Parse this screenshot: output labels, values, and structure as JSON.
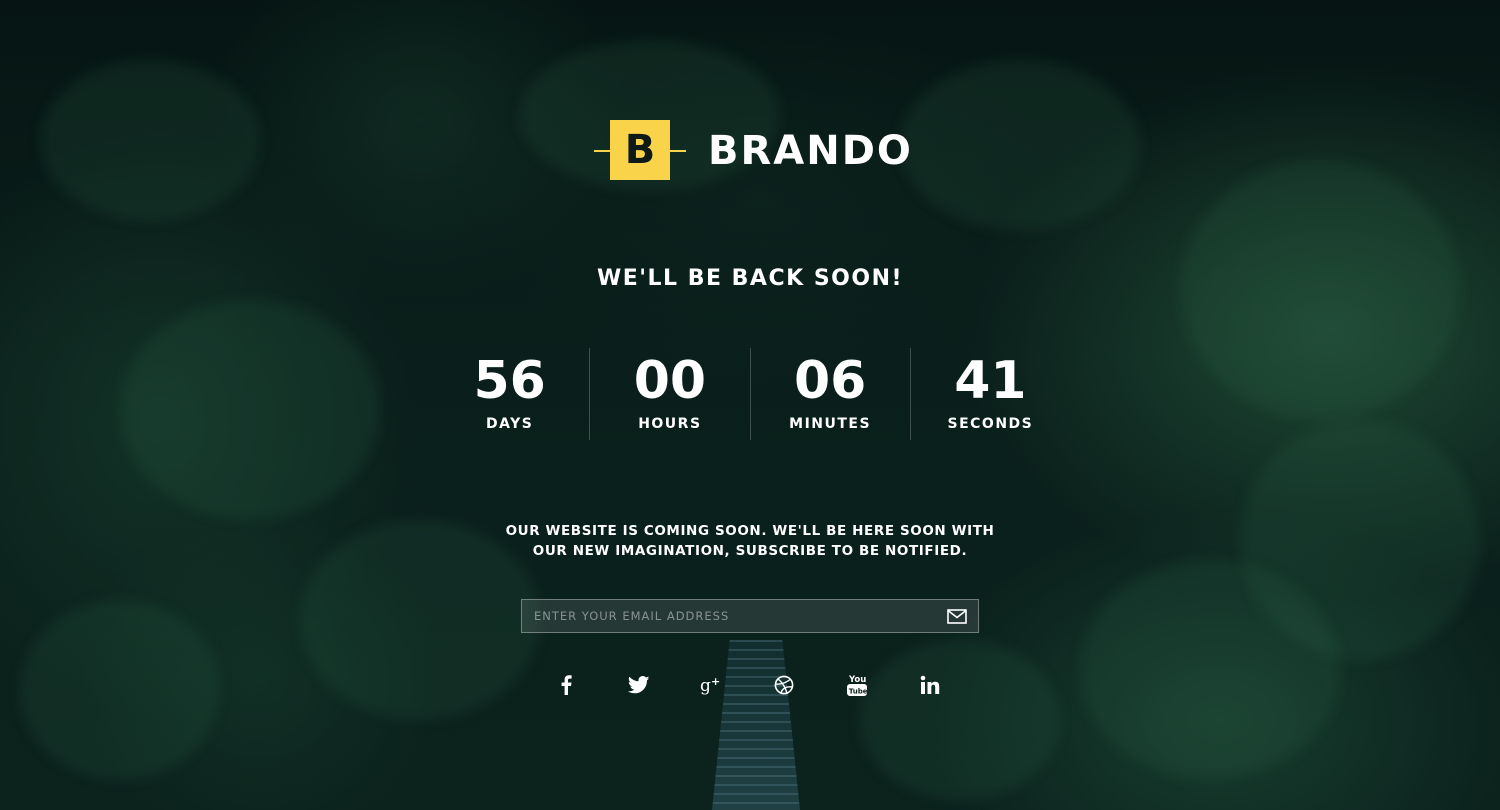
{
  "brand": {
    "logo_letter": "B",
    "name": "BRANDO",
    "accent_color": "#f9d44a"
  },
  "headline": "WE'LL BE BACK SOON!",
  "countdown": [
    {
      "value": "56",
      "label": "DAYS"
    },
    {
      "value": "00",
      "label": "HOURS"
    },
    {
      "value": "06",
      "label": "MINUTES"
    },
    {
      "value": "41",
      "label": "SECONDS"
    }
  ],
  "message": {
    "line1": "OUR WEBSITE IS COMING SOON. WE'LL BE HERE SOON WITH",
    "line2": "OUR NEW IMAGINATION, SUBSCRIBE TO BE NOTIFIED."
  },
  "subscribe": {
    "placeholder": "ENTER YOUR EMAIL ADDRESS",
    "value": "",
    "submit_icon": "envelope-icon"
  },
  "social": [
    {
      "icon": "facebook-icon"
    },
    {
      "icon": "twitter-icon"
    },
    {
      "icon": "google-plus-icon"
    },
    {
      "icon": "dribbble-icon"
    },
    {
      "icon": "youtube-icon"
    },
    {
      "icon": "linkedin-icon"
    }
  ]
}
